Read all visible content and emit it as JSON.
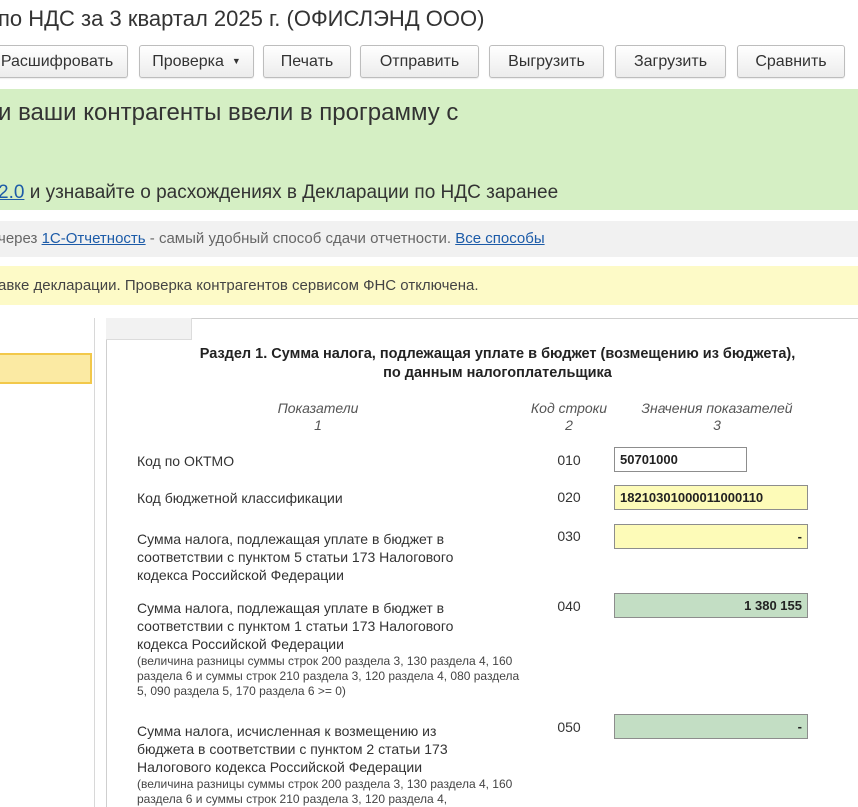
{
  "window": {
    "title": "по НДС за 3 квартал 2025 г. (ОФИСЛЭНД ООО)"
  },
  "toolbar": {
    "decode_label": "Расшифровать",
    "check_label": "Проверка",
    "print_label": "Печать",
    "send_label": "Отправить",
    "export_label": "Выгрузить",
    "load_label": "Загрузить",
    "compare_label": "Сравнить"
  },
  "banners": {
    "green": {
      "line1": "и ваши контрагенты ввели в программу с",
      "link": "2.0",
      "line2_rest": " и узнавайте о расхождениях в Декларации по НДС заранее"
    },
    "gray": {
      "prefix": "через ",
      "link1": "1С-Отчетность",
      "middle": " - самый удобный способ сдачи отчетности. ",
      "link2": "Все способы"
    },
    "yellow": {
      "text": "авке декларации. Проверка контрагентов сервисом ФНС отключена."
    }
  },
  "form": {
    "section_title_line1": "Раздел 1. Сумма налога, подлежащая уплате в бюджет (возмещению из бюджета),",
    "section_title_line2": "по данным налогоплательщика",
    "headers": {
      "col1": "Показатели",
      "col1_num": "1",
      "col2": "Код строки",
      "col2_num": "2",
      "col3": "Значения показателей",
      "col3_num": "3"
    },
    "rows": [
      {
        "label": "Код по ОКТМО",
        "note": "",
        "code": "010",
        "value": "50701000"
      },
      {
        "label": "Код бюджетной классификации",
        "note": "",
        "code": "020",
        "value": "18210301000011000110"
      },
      {
        "label": "Сумма налога, подлежащая уплате в бюджет в соответствии с пунктом 5 статьи 173 Налогового кодекса Российской Федерации",
        "note": "",
        "code": "030",
        "value": "-"
      },
      {
        "label": "Сумма налога, подлежащая уплате в бюджет в соответствии с пунктом 1 статьи 173 Налогового кодекса Российской Федерации",
        "note": "(величина разницы суммы строк 200 раздела 3, 130 раздела 4, 160 раздела 6 и суммы строк 210 раздела 3, 120 раздела 4, 080 раздела 5, 090 раздела 5, 170 раздела 6 >= 0)",
        "code": "040",
        "value": "1 380 155"
      },
      {
        "label": "Сумма налога, исчисленная к возмещению из бюджета в соответствии с пунктом 2 статьи 173 Налогового кодекса Российской Федерации",
        "note": "(величина разницы суммы строк 200 раздела 3, 130 раздела 4, 160 раздела 6 и суммы строк 210 раздела 3, 120 раздела 4,",
        "code": "050",
        "value": "-"
      }
    ]
  },
  "colors": {
    "green_banner": "#d5efc4",
    "gray_banner": "#f1f1f1",
    "yellow_banner": "#fdfac7",
    "field_yellow": "#fdfbb8",
    "field_green": "#c3dec4",
    "link": "#1c5ba8"
  }
}
